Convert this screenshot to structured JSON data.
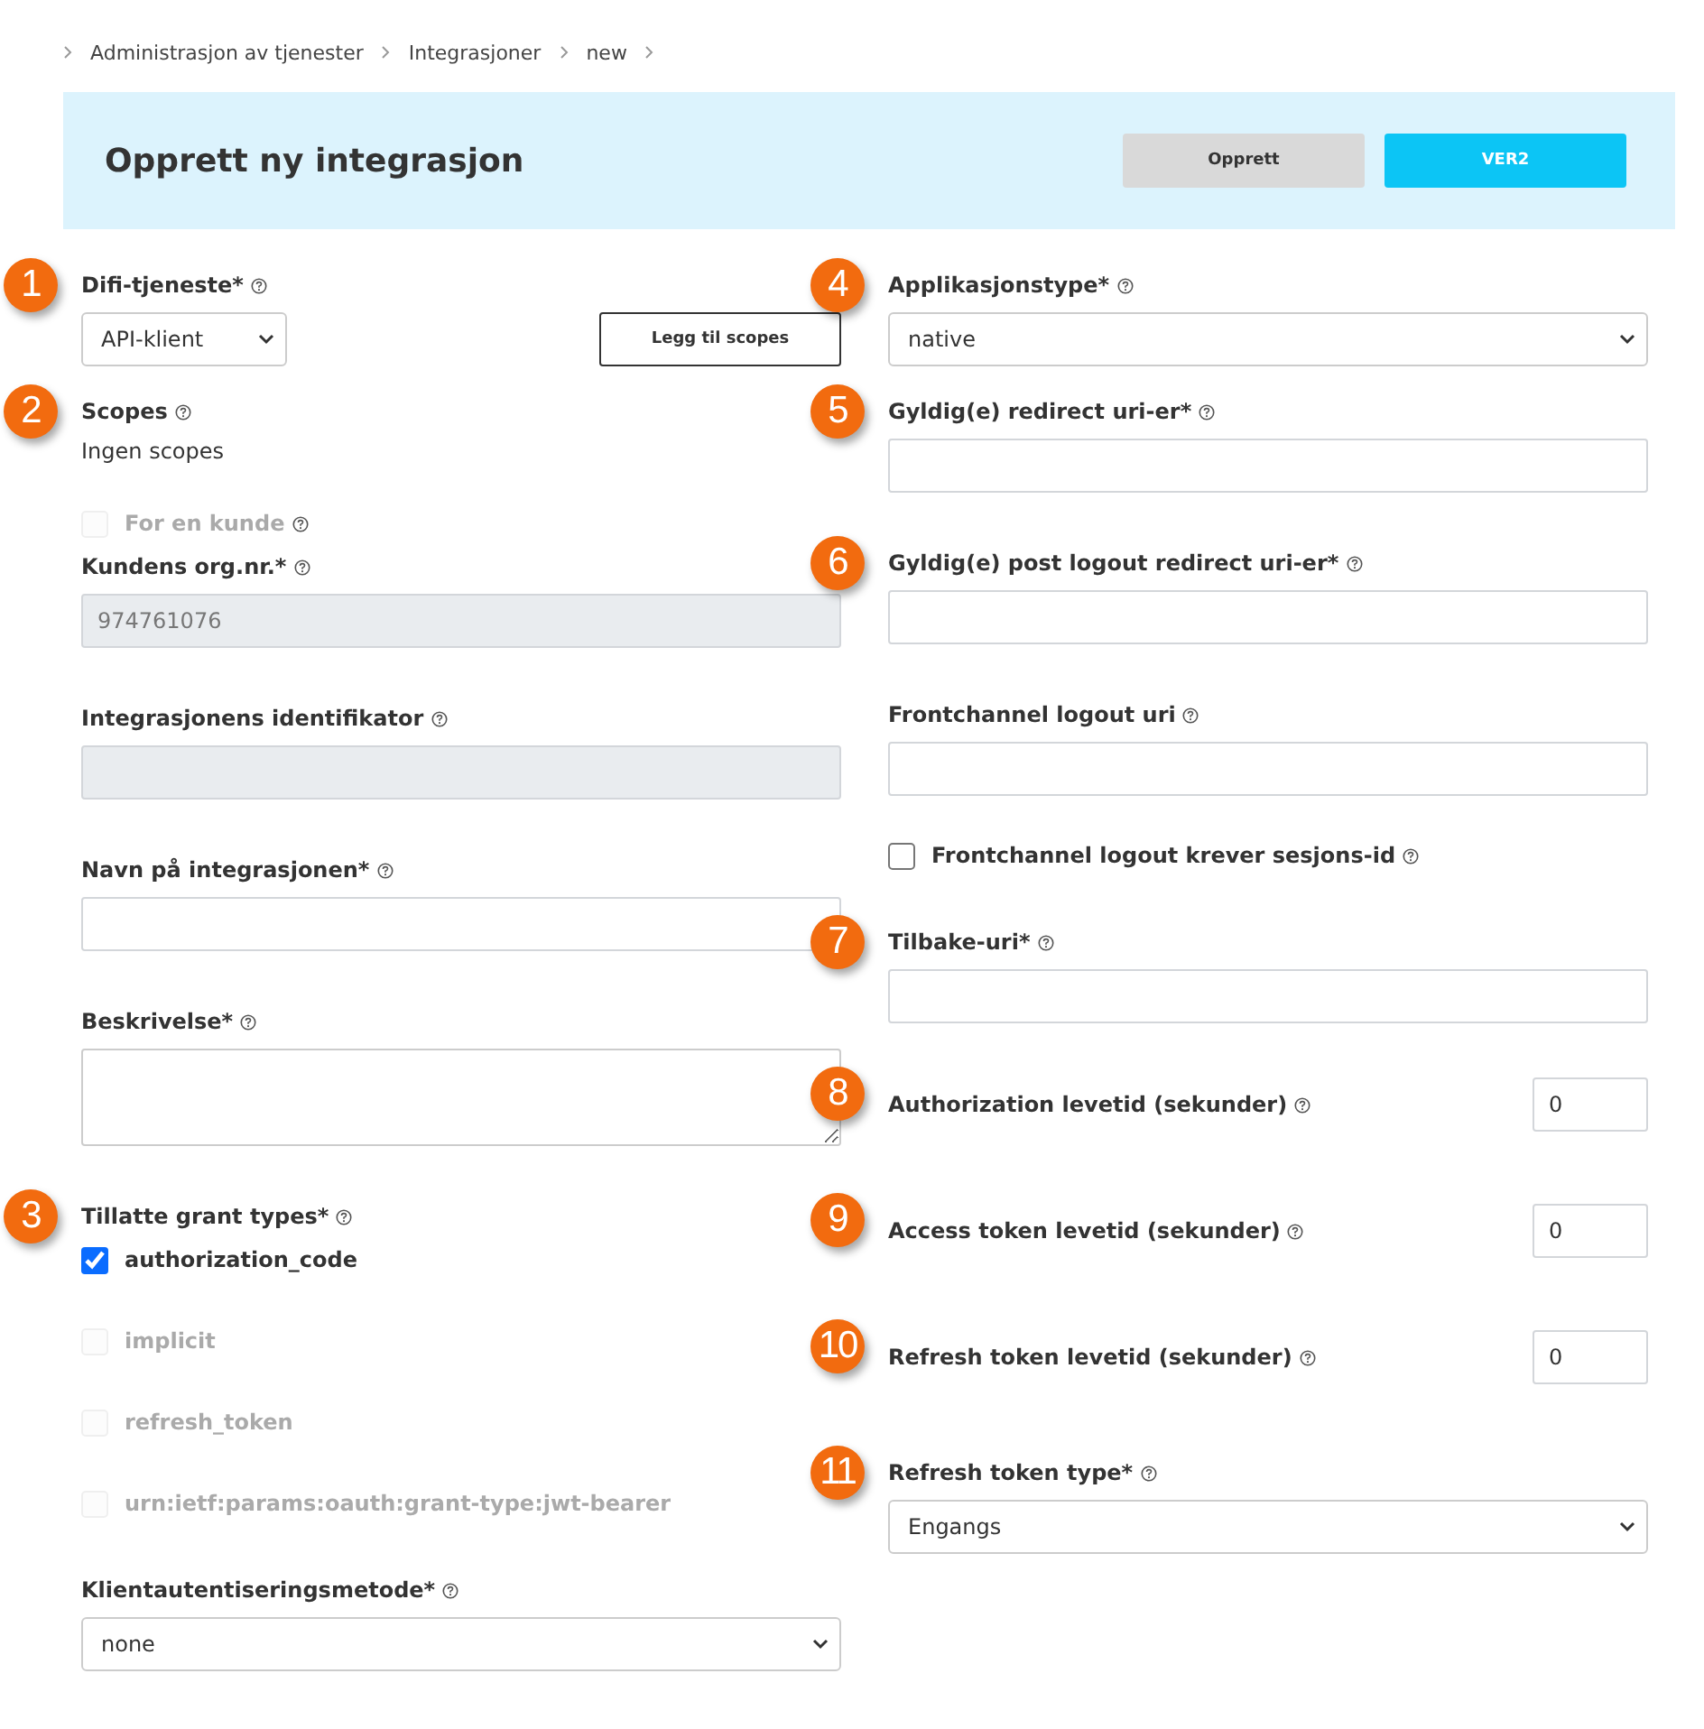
{
  "breadcrumb": [
    {
      "label": "Administrasjon av tjenester"
    },
    {
      "label": "Integrasjoner"
    },
    {
      "label": "new"
    }
  ],
  "header": {
    "title": "Opprett ny integrasjon",
    "buttons": [
      {
        "label": "Opprett",
        "kind": "secondary"
      },
      {
        "label": "VER2",
        "kind": "primary"
      }
    ]
  },
  "left_column": [
    {
      "kind": "select",
      "badge": "1",
      "label": "Difi-tjeneste*",
      "value": "API-klient",
      "action_button": "Legg til scopes"
    },
    {
      "kind": "static",
      "badge": "2",
      "label": "Scopes",
      "value": "Ingen scopes"
    },
    {
      "kind": "checkbox",
      "label": "For en kunde",
      "checked": false,
      "disabled": true
    },
    {
      "kind": "text",
      "label": "Kundens org.nr.*",
      "value": "974761076",
      "disabled": true
    },
    {
      "kind": "text",
      "label": "Integrasjonens identifikator",
      "disabled": true
    },
    {
      "kind": "text",
      "label": "Navn på integrasjonen*",
      "disabled": false
    },
    {
      "kind": "textarea",
      "label": "Beskrivelse*"
    },
    {
      "kind": "checkgroup",
      "badge": "3",
      "label": "Tillatte grant types*",
      "options": [
        {
          "label": "authorization_code",
          "checked": true,
          "disabled": false
        },
        {
          "label": "implicit",
          "checked": false,
          "disabled": true
        },
        {
          "label": "refresh_token",
          "checked": false,
          "disabled": true
        },
        {
          "label": "urn:ietf:params:oauth:grant-type:jwt-bearer",
          "checked": false,
          "disabled": true
        }
      ]
    },
    {
      "kind": "select",
      "label": "Klientautentiseringsmetode*",
      "value": "none"
    }
  ],
  "right_column": [
    {
      "kind": "select",
      "badge": "4",
      "label": "Applikasjonstype*",
      "value": "native"
    },
    {
      "kind": "text",
      "badge": "5",
      "label": "Gyldig(e) redirect uri-er*",
      "disabled": false
    },
    {
      "kind": "text",
      "badge": "6",
      "label": "Gyldig(e) post logout redirect uri-er*",
      "disabled": false
    },
    {
      "kind": "text",
      "label": "Frontchannel logout uri",
      "disabled": false
    },
    {
      "kind": "checkbox",
      "label": "Frontchannel logout krever sesjons-id",
      "checked": false,
      "disabled": false
    },
    {
      "kind": "text",
      "badge": "7",
      "label": "Tilbake-uri*",
      "disabled": false
    },
    {
      "kind": "number",
      "badge": "8",
      "label": "Authorization levetid (sekunder)",
      "value": "0"
    },
    {
      "kind": "number",
      "badge": "9",
      "label": "Access token levetid (sekunder)",
      "value": "0"
    },
    {
      "kind": "number",
      "badge": "10",
      "label": "Refresh token levetid (sekunder)",
      "value": "0"
    },
    {
      "kind": "select",
      "badge": "11",
      "label": "Refresh token type*",
      "value": "Engangs"
    }
  ]
}
